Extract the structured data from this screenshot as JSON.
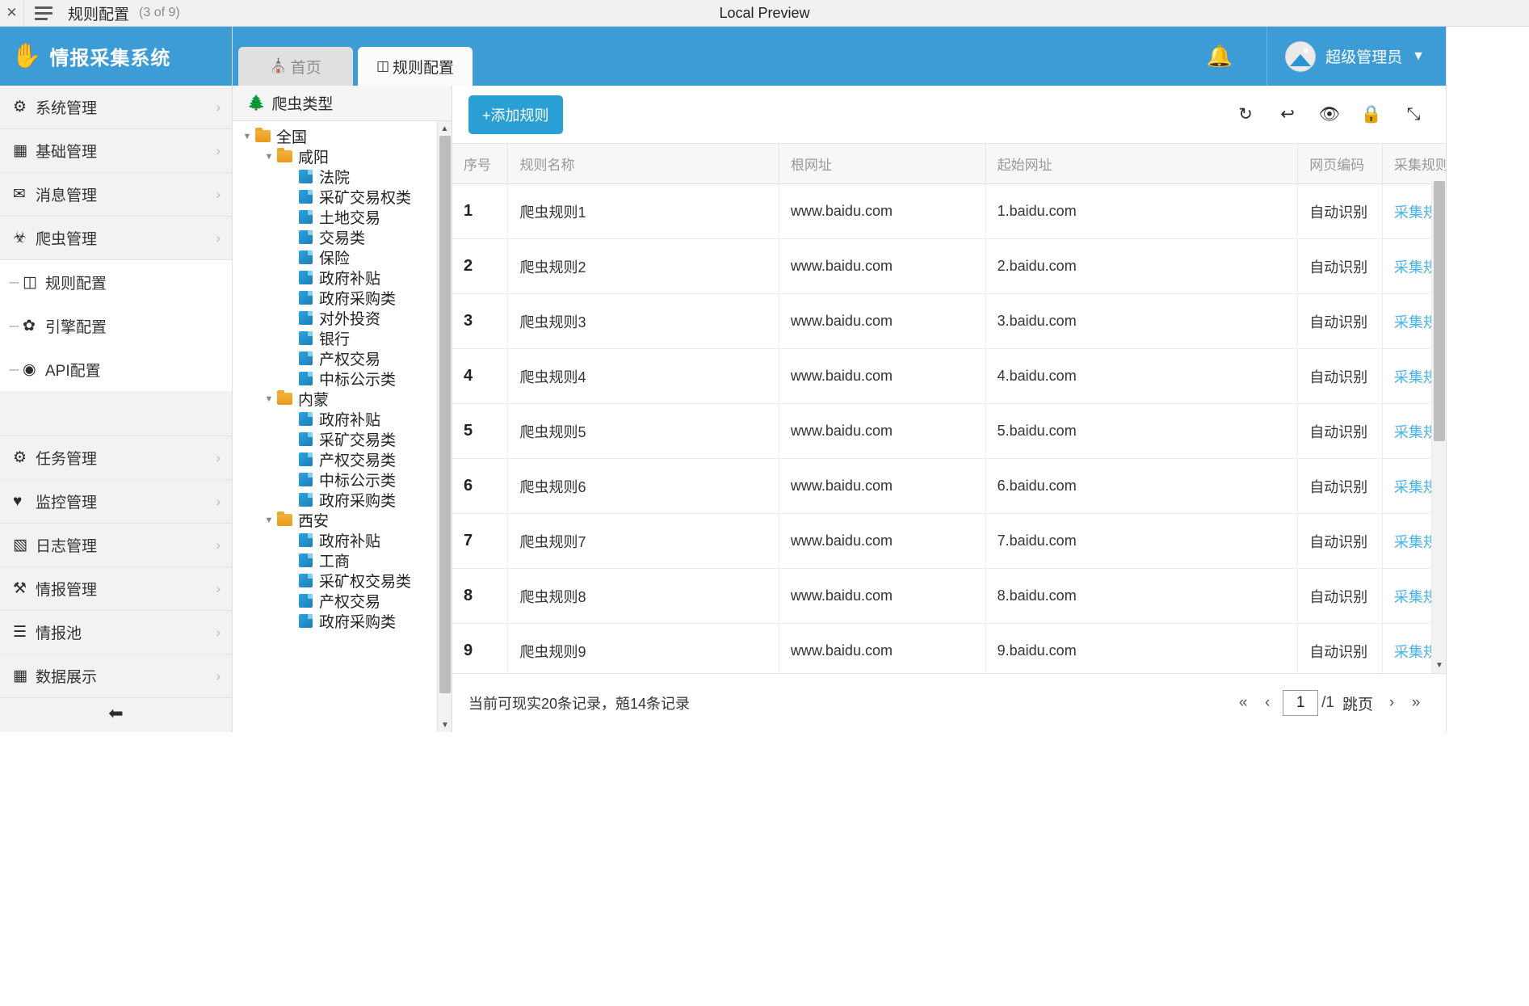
{
  "chrome": {
    "close_label": "✕",
    "title": "规则配置",
    "count": "(3 of 9)",
    "center_title": "Local Preview"
  },
  "brand": {
    "icon": "hand-icon",
    "title": "情报采集系统"
  },
  "sidebar": {
    "groups": [
      {
        "label": "系统管理",
        "icon": "gears-icon",
        "glyph": "⚙",
        "chevron": "›",
        "type": "group"
      },
      {
        "label": "基础管理",
        "icon": "table-icon",
        "glyph": "▦",
        "chevron": "›",
        "type": "group"
      },
      {
        "label": "消息管理",
        "icon": "envelope-icon",
        "glyph": "✉",
        "chevron": "›",
        "type": "group"
      },
      {
        "label": "爬虫管理",
        "icon": "bug-icon",
        "glyph": "☥",
        "chevron": "›",
        "type": "group"
      },
      {
        "label": "规则配置",
        "icon": "code-file-icon",
        "glyph": "☷",
        "chevron": "",
        "type": "sub"
      },
      {
        "label": "引擎配置",
        "icon": "paw-icon",
        "glyph": "✿",
        "chevron": "",
        "type": "sub"
      },
      {
        "label": "API配置",
        "icon": "api-icon",
        "glyph": "◉",
        "chevron": "",
        "type": "sub"
      },
      {
        "label": "",
        "icon": "",
        "glyph": "",
        "chevron": "",
        "type": "gap"
      },
      {
        "label": "任务管理",
        "icon": "gear-icon",
        "glyph": "⚙",
        "chevron": "›",
        "type": "group"
      },
      {
        "label": "监控管理",
        "icon": "heartbeat-icon",
        "glyph": "♥",
        "chevron": "›",
        "type": "group"
      },
      {
        "label": "日志管理",
        "icon": "book-icon",
        "glyph": "◧",
        "chevron": "›",
        "type": "group"
      },
      {
        "label": "情报管理",
        "icon": "wrench-icon",
        "glyph": "⚒",
        "chevron": "›",
        "type": "group"
      },
      {
        "label": "情报池",
        "icon": "database-icon",
        "glyph": "☰",
        "chevron": "›",
        "type": "group"
      },
      {
        "label": "数据展示",
        "icon": "grid-icon",
        "glyph": "▦",
        "chevron": "›",
        "type": "group"
      }
    ],
    "collapse_icon": "collapse-left-icon",
    "collapse_glyph": "⬅"
  },
  "topbar": {
    "tabs": [
      {
        "label": "首页",
        "icon": "home-icon",
        "glyph": "⌂",
        "active": false
      },
      {
        "label": "规则配置",
        "icon": "code-file-icon",
        "glyph": "☷",
        "active": true
      }
    ],
    "bell_icon": "bell-icon",
    "bell_glyph": "␇",
    "user_name": "超级管理员",
    "user_caret": "▼",
    "accent_color": "#3d9bd6"
  },
  "tree": {
    "header": "爬虫类型",
    "header_icon": "tree-icon",
    "header_glyph": "♣",
    "nodes": [
      {
        "label": "全国",
        "depth": 0,
        "type": "folder",
        "caret": "▼"
      },
      {
        "label": "咸阳",
        "depth": 1,
        "type": "folder",
        "caret": "▼"
      },
      {
        "label": "法院",
        "depth": 2,
        "type": "leaf",
        "caret": ""
      },
      {
        "label": "采矿交易权类",
        "depth": 2,
        "type": "leaf",
        "caret": ""
      },
      {
        "label": "土地交易",
        "depth": 2,
        "type": "leaf",
        "caret": ""
      },
      {
        "label": "交易类",
        "depth": 2,
        "type": "leaf",
        "caret": ""
      },
      {
        "label": "保险",
        "depth": 2,
        "type": "leaf",
        "caret": ""
      },
      {
        "label": "政府补贴",
        "depth": 2,
        "type": "leaf",
        "caret": ""
      },
      {
        "label": "政府采购类",
        "depth": 2,
        "type": "leaf",
        "caret": ""
      },
      {
        "label": "对外投资",
        "depth": 2,
        "type": "leaf",
        "caret": ""
      },
      {
        "label": "银行",
        "depth": 2,
        "type": "leaf",
        "caret": ""
      },
      {
        "label": "产权交易",
        "depth": 2,
        "type": "leaf",
        "caret": ""
      },
      {
        "label": "中标公示类",
        "depth": 2,
        "type": "leaf",
        "caret": ""
      },
      {
        "label": "内蒙",
        "depth": 1,
        "type": "folder",
        "caret": "▼"
      },
      {
        "label": "政府补贴",
        "depth": 2,
        "type": "leaf",
        "caret": ""
      },
      {
        "label": "采矿交易类",
        "depth": 2,
        "type": "leaf",
        "caret": ""
      },
      {
        "label": "产权交易类",
        "depth": 2,
        "type": "leaf",
        "caret": ""
      },
      {
        "label": "中标公示类",
        "depth": 2,
        "type": "leaf",
        "caret": ""
      },
      {
        "label": "政府采购类",
        "depth": 2,
        "type": "leaf",
        "caret": ""
      },
      {
        "label": "西安",
        "depth": 1,
        "type": "folder",
        "caret": "▼"
      },
      {
        "label": "政府补贴",
        "depth": 2,
        "type": "leaf",
        "caret": ""
      },
      {
        "label": "工商",
        "depth": 2,
        "type": "leaf",
        "caret": ""
      },
      {
        "label": "采矿权交易类",
        "depth": 2,
        "type": "leaf",
        "caret": ""
      },
      {
        "label": "产权交易",
        "depth": 2,
        "type": "leaf",
        "caret": ""
      },
      {
        "label": "政府采购类",
        "depth": 2,
        "type": "leaf",
        "caret": ""
      }
    ],
    "scroll_up": "▲",
    "scroll_down": "▼"
  },
  "toolbar": {
    "add_label": "+添加规则",
    "icons": [
      {
        "name": "refresh-icon",
        "glyph": "↻"
      },
      {
        "name": "undo-icon",
        "glyph": "↩"
      },
      {
        "name": "eye-icon",
        "glyph": "◉"
      },
      {
        "name": "lock-icon",
        "glyph": "ὑ2"
      },
      {
        "name": "expand-icon",
        "glyph": "⤡"
      }
    ]
  },
  "table": {
    "columns": [
      "序号",
      "规则名称",
      "根网址",
      "起始网址",
      "网页编码",
      "采集规则"
    ],
    "rows": [
      {
        "idx": "1",
        "name": "爬虫规则1",
        "root": "www.baidu.com",
        "start": "1.baidu.com",
        "enc": "自动识别",
        "rule": "采集规"
      },
      {
        "idx": "2",
        "name": "爬虫规则2",
        "root": "www.baidu.com",
        "start": "2.baidu.com",
        "enc": "自动识别",
        "rule": "采集规"
      },
      {
        "idx": "3",
        "name": "爬虫规则3",
        "root": "www.baidu.com",
        "start": "3.baidu.com",
        "enc": "自动识别",
        "rule": "采集规"
      },
      {
        "idx": "4",
        "name": "爬虫规则4",
        "root": "www.baidu.com",
        "start": "4.baidu.com",
        "enc": "自动识别",
        "rule": "采集规"
      },
      {
        "idx": "5",
        "name": "爬虫规则5",
        "root": "www.baidu.com",
        "start": "5.baidu.com",
        "enc": "自动识别",
        "rule": "采集规"
      },
      {
        "idx": "6",
        "name": "爬虫规则6",
        "root": "www.baidu.com",
        "start": "6.baidu.com",
        "enc": "自动识别",
        "rule": "采集规"
      },
      {
        "idx": "7",
        "name": "爬虫规则7",
        "root": "www.baidu.com",
        "start": "7.baidu.com",
        "enc": "自动识别",
        "rule": "采集规"
      },
      {
        "idx": "8",
        "name": "爬虫规则8",
        "root": "www.baidu.com",
        "start": "8.baidu.com",
        "enc": "自动识别",
        "rule": "采集规"
      },
      {
        "idx": "9",
        "name": "爬虫规则9",
        "root": "www.baidu.com",
        "start": "9.baidu.com",
        "enc": "自动识别",
        "rule": "采集规"
      },
      {
        "idx": "",
        "name": "",
        "root": "",
        "start": "",
        "enc": "",
        "rule": ""
      }
    ]
  },
  "footer": {
    "info": "当前可现实20条记录，兡14条记录",
    "first": "«",
    "prev": "‹",
    "page_value": "1",
    "total_pages": "/1",
    "jump": "跳页",
    "next": "›",
    "last": "»"
  }
}
